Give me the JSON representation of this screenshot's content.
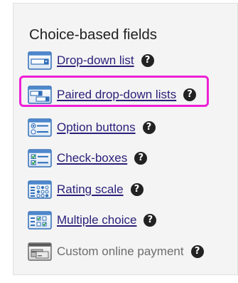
{
  "panel": {
    "title": "Choice-based fields",
    "items": [
      {
        "label": "Drop-down list",
        "icon": "dropdown-list-icon",
        "enabled": true
      },
      {
        "label": "Paired drop-down lists",
        "icon": "paired-dropdown-icon",
        "enabled": true,
        "highlighted": true
      },
      {
        "label": "Option buttons",
        "icon": "option-buttons-icon",
        "enabled": true
      },
      {
        "label": "Check-boxes",
        "icon": "checkboxes-icon",
        "enabled": true
      },
      {
        "label": "Rating scale",
        "icon": "rating-scale-icon",
        "enabled": true
      },
      {
        "label": "Multiple choice",
        "icon": "multiple-choice-icon",
        "enabled": true
      },
      {
        "label": "Custom online payment",
        "icon": "payment-icon",
        "enabled": false
      }
    ],
    "help_glyph": "?"
  },
  "colors": {
    "link": "#2a1f7a",
    "disabled_text": "#6d6d6d",
    "highlight_border": "#ee20d6",
    "panel_background": "#f4f4f4",
    "icon_blue": "#2f6db8",
    "icon_green": "#27a33a"
  }
}
